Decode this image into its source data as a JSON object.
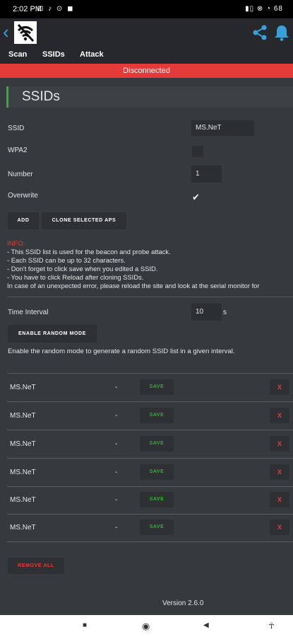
{
  "status_bar": {
    "time": "2:02 PM",
    "icons": "⊡ ♪ ⊙ ◼",
    "right": "▮▯ ⊗ ◔ 68"
  },
  "nav": {
    "items": [
      "Scan",
      "SSIDs",
      "Attack"
    ]
  },
  "banner": "Disconnected",
  "page_title": "SSIDs",
  "form": {
    "ssid_label": "SSID",
    "ssid_value": "MS.NeT",
    "wpa2_label": "WPA2",
    "number_label": "Number",
    "number_value": "1",
    "overwrite_label": "Overwrite",
    "overwrite_check": "✔"
  },
  "buttons": {
    "add": "ADD",
    "clone": "CLONE SELECTED APS",
    "random": "ENABLE RANDOM MODE",
    "remove_all": "REMOVE ALL"
  },
  "info": {
    "head": "INFO:",
    "lines": [
      "- This SSID list is used for the beacon and probe attack.",
      "- Each SSID can be up to 32 characters.",
      "- Don't forget to click save when you edited a SSID.",
      "- You have to click Reload after cloning SSIDs.",
      "In case of an unexpected error, please reload the site and look at the serial monitor for"
    ]
  },
  "time_interval": {
    "label": "Time Interval",
    "value": "10",
    "unit": "s"
  },
  "random_desc": "Enable the random mode to generate a random SSID list in a given interval.",
  "ssid_list": [
    {
      "name": "MS.NeT",
      "sep": "-",
      "save": "SAVE",
      "del": "X"
    },
    {
      "name": "MS.NeT",
      "sep": "-",
      "save": "SAVE",
      "del": "X"
    },
    {
      "name": "MS.NeT",
      "sep": "-",
      "save": "SAVE",
      "del": "X"
    },
    {
      "name": "MS.NeT",
      "sep": "-",
      "save": "SAVE",
      "del": "X"
    },
    {
      "name": "MS.NeT",
      "sep": "-",
      "save": "SAVE",
      "del": "X"
    },
    {
      "name": "MS.NeT",
      "sep": "-",
      "save": "SAVE",
      "del": "X"
    }
  ],
  "version": "Version 2.6.0",
  "system_nav": {
    "recent": "■",
    "home": "◉",
    "back": "◀",
    "accessibility": "☥"
  },
  "colors": {
    "accent_red": "#e53a3a",
    "accent_green": "#2fb02f",
    "link_blue": "#39a0dc"
  }
}
